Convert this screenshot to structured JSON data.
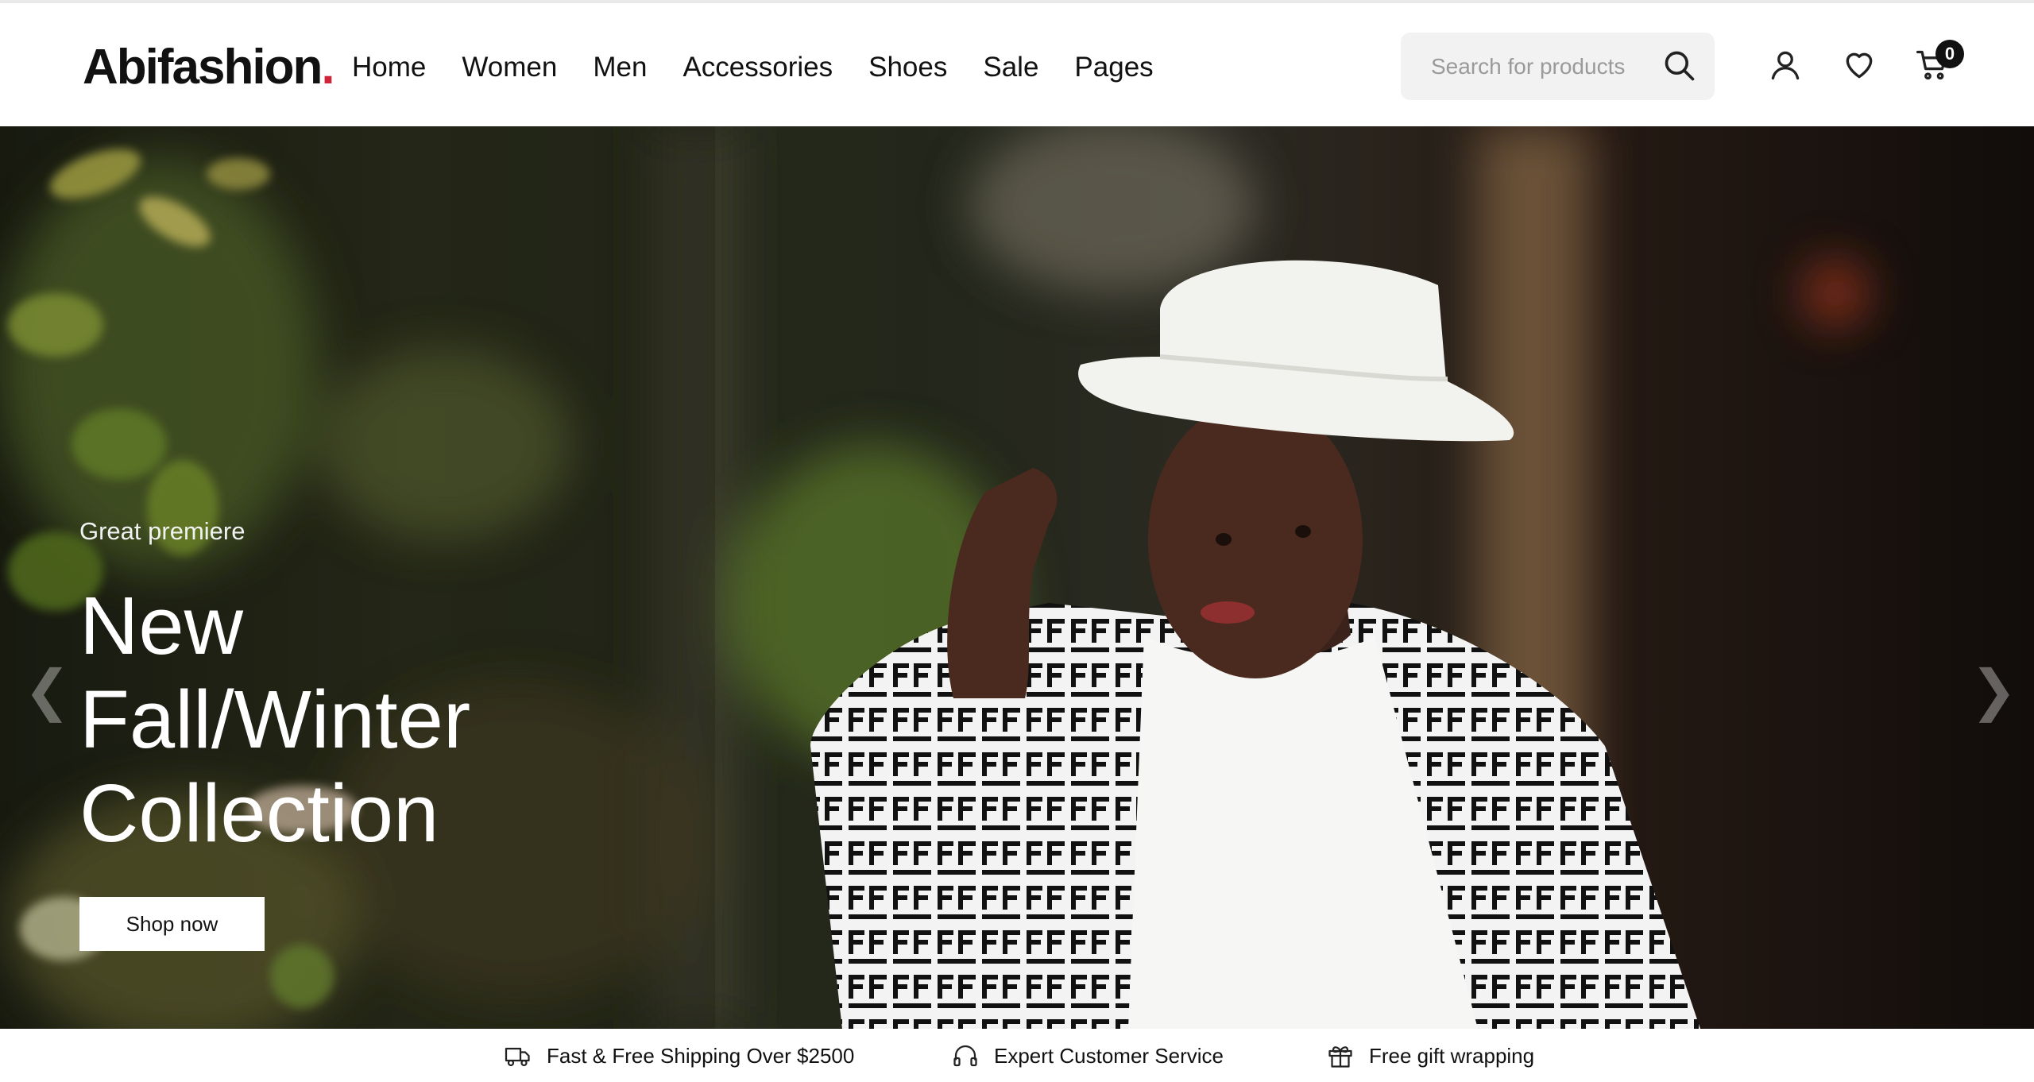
{
  "brand": {
    "name": "Abifashion",
    "dot": ".",
    "dot_color": "#d0243b"
  },
  "nav": {
    "items": [
      {
        "label": "Home"
      },
      {
        "label": "Women"
      },
      {
        "label": "Men"
      },
      {
        "label": "Accessories"
      },
      {
        "label": "Shoes"
      },
      {
        "label": "Sale"
      },
      {
        "label": "Pages"
      }
    ]
  },
  "search": {
    "placeholder": "Search for products",
    "icon": "search-icon"
  },
  "header_icons": {
    "account": "user-icon",
    "wishlist": "heart-icon",
    "cart": "cart-icon",
    "cart_count": "0"
  },
  "hero": {
    "subtitle": "Great premiere",
    "title_lines": [
      "New",
      "Fall/Winter",
      "Collection"
    ],
    "cta": "Shop now",
    "prev": "❮",
    "next": "❯"
  },
  "features": [
    {
      "icon": "truck-icon",
      "label": "Fast & Free Shipping Over $2500"
    },
    {
      "icon": "headphones-icon",
      "label": "Expert Customer Service"
    },
    {
      "icon": "gift-icon",
      "label": "Free gift wrapping"
    }
  ]
}
